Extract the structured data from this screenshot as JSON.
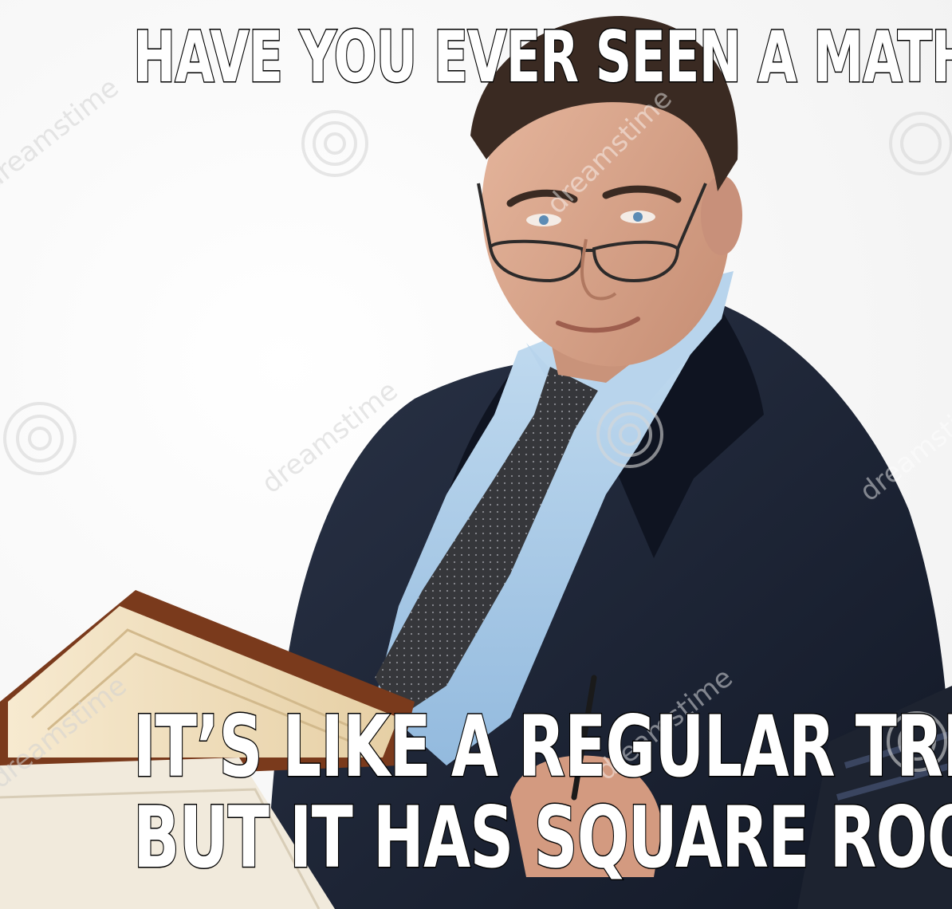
{
  "meme": {
    "top_text": "HAVE YOU EVER SEEN A MATH TREE?",
    "bottom_lines": [
      "IT’S LIKE A REGULAR TREE,",
      "BUT IT HAS SQUARE ROOTS"
    ]
  },
  "watermark": {
    "text": "dreamstime",
    "logo_icon": "swirl-logo-icon"
  },
  "colors": {
    "background": "#ffffff",
    "suit": "#1c2333",
    "shirt": "#a9cbe8",
    "tie": "#3a3b3f",
    "skin": "#d9a58c",
    "hair": "#3a2a22",
    "book_cover": "#7a3a1c",
    "book_pages": "#f2e2c0"
  }
}
